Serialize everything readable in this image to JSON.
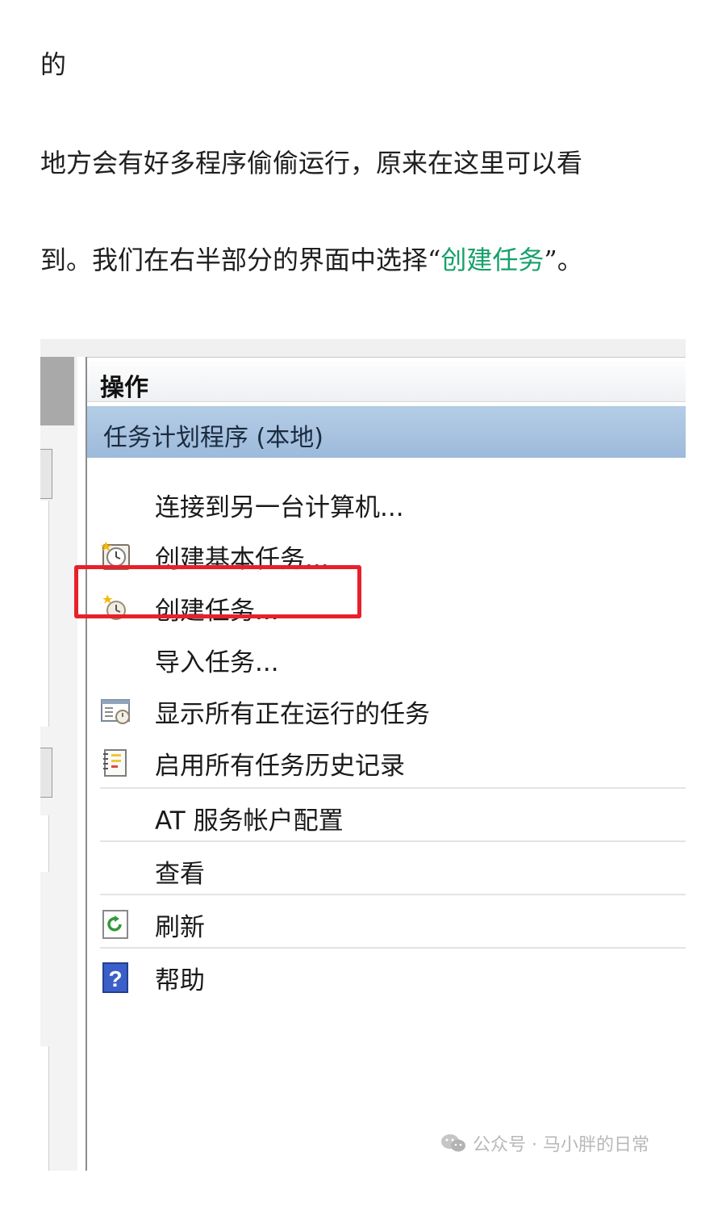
{
  "article": {
    "line1": "的",
    "line2": "地方会有好多程序偷偷运行，原来在这里可以看",
    "line3_before": "到。我们在右半部分的界面中选择“",
    "line3_highlight": "创建任务",
    "line3_after": "”。"
  },
  "actions_pane": {
    "header": "操作",
    "section_title": "任务计划程序 (本地)",
    "items": [
      {
        "label": "连接到另一台计算机...",
        "icon": "none"
      },
      {
        "label": "创建基本任务...",
        "icon": "create-basic-task-icon"
      },
      {
        "label": "创建任务...",
        "icon": "create-task-icon",
        "highlighted": true
      },
      {
        "label": "导入任务...",
        "icon": "none"
      },
      {
        "label": "显示所有正在运行的任务",
        "icon": "running-tasks-icon"
      },
      {
        "label": "启用所有任务历史记录",
        "icon": "task-history-icon"
      },
      {
        "label": "AT 服务帐户配置",
        "icon": "none"
      },
      {
        "label": "查看",
        "icon": "none"
      },
      {
        "label": "刷新",
        "icon": "refresh-icon"
      },
      {
        "label": "帮助",
        "icon": "help-icon"
      }
    ]
  },
  "watermark": {
    "text": "公众号 · 马小胖的日常"
  },
  "colors": {
    "highlight_text": "#17a06b",
    "red_box": "#e8202a",
    "section_bar": "#a9c3e0"
  }
}
